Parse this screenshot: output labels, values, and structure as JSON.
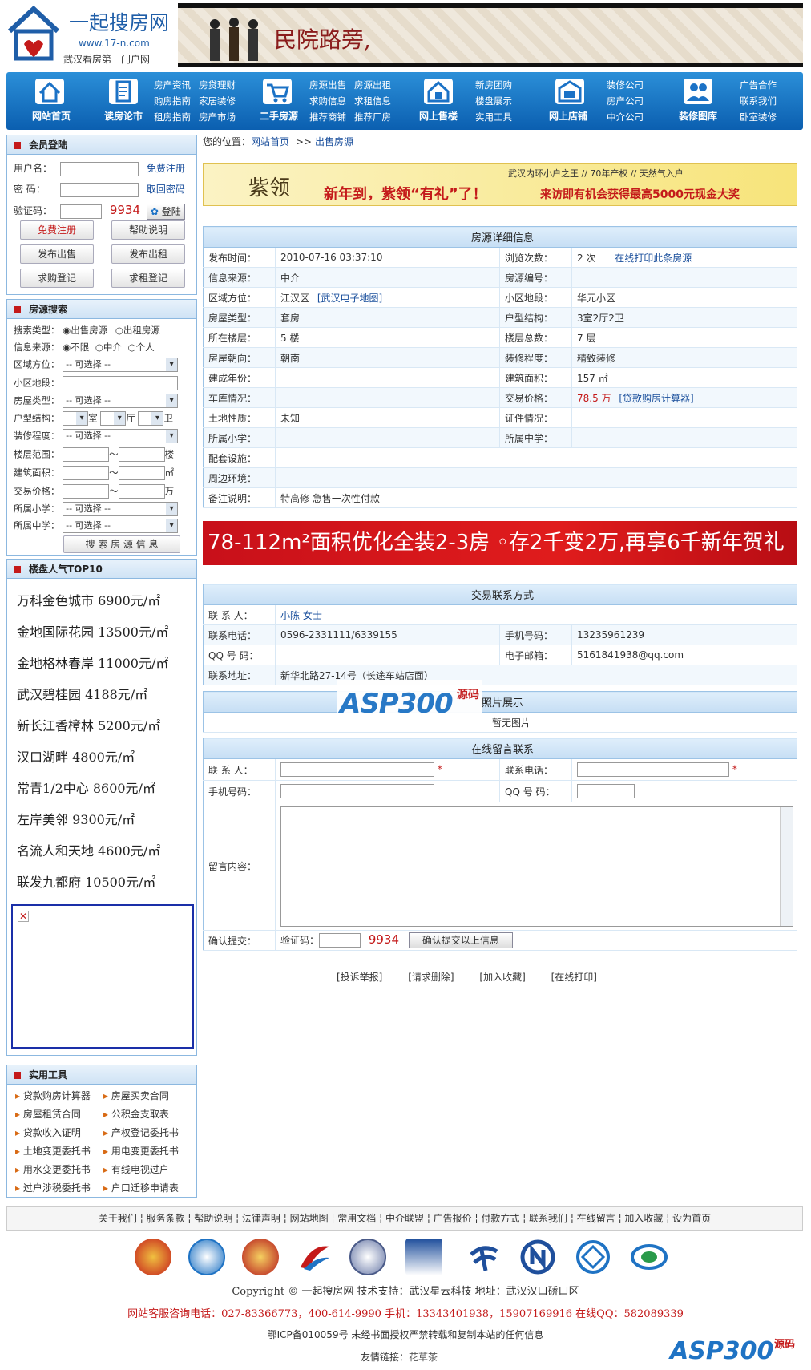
{
  "logo": {
    "title": "一起搜房网",
    "url": "www.17-n.com",
    "slogan": "武汉看房第一门户网"
  },
  "banner": {
    "text": "民院路旁,"
  },
  "nav": {
    "items": [
      {
        "label": "网站首页",
        "links": []
      },
      {
        "label": "读房论市",
        "links": [
          "房产资讯",
          "房贷理财",
          "购房指南",
          "家居装修",
          "租房指南",
          "房产市场"
        ]
      },
      {
        "label": "二手房源",
        "links": [
          "房源出售",
          "房源出租",
          "求购信息",
          "求租信息",
          "推荐商铺",
          "推荐厂房"
        ]
      },
      {
        "label": "网上售楼",
        "links": [
          "新房团购",
          "楼盘展示",
          "实用工具"
        ]
      },
      {
        "label": "网上店铺",
        "links": [
          "装修公司",
          "房产公司",
          "中介公司"
        ]
      },
      {
        "label": "装修图库",
        "links": [
          "广告合作",
          "联系我们",
          "卧室装修"
        ]
      }
    ]
  },
  "login": {
    "title": "会员登陆",
    "username_label": "用户名：",
    "password_label": "密  码：",
    "captcha_label": "验证码：",
    "captcha": "9934",
    "register_link": "免费注册",
    "forgot_link": "取回密码",
    "login_button": "登陆",
    "buttons": [
      "免费注册",
      "帮助说明",
      "发布出售",
      "发布出租",
      "求购登记",
      "求租登记"
    ]
  },
  "search": {
    "title": "房源搜索",
    "type_label": "搜索类型：",
    "type_options": [
      "出售房源",
      "出租房源"
    ],
    "source_label": "信息来源：",
    "source_options": [
      "不限",
      "中介",
      "个人"
    ],
    "district_label": "区域方位：",
    "community_label": "小区地段：",
    "housetype_label": "房屋类型：",
    "layout_label": "户型结构：",
    "layout_units": [
      "室",
      "厅",
      "卫"
    ],
    "decor_label": "装修程度：",
    "floor_label": "楼层范围：",
    "floor_unit": "楼",
    "area_label": "建筑面积：",
    "area_unit": "㎡",
    "price_label": "交易价格：",
    "price_unit": "万",
    "primary_label": "所属小学：",
    "middle_label": "所属中学：",
    "select_default": "-- 可选择 --",
    "tilde": "～",
    "search_button": "搜 索 房 源 信 息"
  },
  "top10": {
    "title": "楼盘人气TOP10",
    "items": [
      "万科金色城市  6900元/㎡",
      "金地国际花园  13500元/㎡",
      "金地格林春岸  11000元/㎡",
      "武汉碧桂园  4188元/㎡",
      "新长江香樟林  5200元/㎡",
      "汉口湖畔  4800元/㎡",
      "常青1/2中心  8600元/㎡",
      "左岸美邻  9300元/㎡",
      "名流人和天地  4600元/㎡",
      "联发九都府  10500元/㎡"
    ]
  },
  "tools": {
    "title": "实用工具",
    "items": [
      "贷款购房计算器",
      "房屋买卖合同",
      "房屋租赁合同",
      "公积金支取表",
      "贷款收入证明",
      "产权登记委托书",
      "土地变更委托书",
      "用电变更委托书",
      "用水变更委托书",
      "有线电视过户",
      "过户涉税委托书",
      "户口迁移申请表"
    ]
  },
  "breadcrumb": {
    "prefix": "您的位置：",
    "home": "网站首页",
    "sep": ">>",
    "current": "出售房源"
  },
  "ad": {
    "brand": "紫领",
    "line1": "武汉内环小户之王 // 70年产权 // 天然气入户",
    "line2": "新年到，紫领“有礼”了！",
    "line3": "来访即有机会获得最高5000元现金大奖"
  },
  "detail": {
    "title": "房源详细信息",
    "rows": [
      [
        "发布时间：",
        "2010-07-16 03:37:10",
        "浏览次数：",
        "2 次"
      ],
      [
        "信息来源：",
        "中介",
        "房源编号：",
        ""
      ],
      [
        "区域方位：",
        "江汉区",
        "小区地段：",
        "华元小区"
      ],
      [
        "房屋类型：",
        "套房",
        "户型结构：",
        "3室2厅2卫"
      ],
      [
        "所在楼层：",
        "5 楼",
        "楼层总数：",
        "7 层"
      ],
      [
        "房屋朝向：",
        "朝南",
        "装修程度：",
        "精致装修"
      ],
      [
        "建成年份：",
        "",
        "建筑面积：",
        "157 ㎡"
      ],
      [
        "车库情况：",
        "",
        "交易价格：",
        "78.5 万"
      ],
      [
        "土地性质：",
        "未知",
        "证件情况：",
        ""
      ],
      [
        "所属小学：",
        "",
        "所属中学：",
        ""
      ]
    ],
    "print_link": "在线打印此条房源",
    "map_link": "[武汉电子地图]",
    "calc_link": "[贷款购房计算器]",
    "facilities_label": "配套设施：",
    "surroundings_label": "周边环境：",
    "remark_label": "备注说明：",
    "remark": "特高修 急售一次性付款"
  },
  "redbanner": {
    "text": "78-112m²面积优化全装2-3房     ◦存2千变2万,再享6千新年贺礼"
  },
  "contact": {
    "title": "交易联系方式",
    "name_label": "联 系 人：",
    "name": "小陈 女士",
    "phone_label": "联系电话：",
    "phone": "0596-2331111/6339155",
    "mobile_label": "手机号码：",
    "mobile": "13235961239",
    "qq_label": "QQ 号 码：",
    "qq": "",
    "email_label": "电子邮箱：",
    "email": "5161841938@qq.com",
    "addr_label": "联系地址：",
    "addr": "新华北路27-14号（长途车站店面）"
  },
  "photos": {
    "title": "照片展示",
    "empty": "暂无图片",
    "watermark": "ASP300",
    "watermark_sub": "源码"
  },
  "message": {
    "title": "在线留言联系",
    "name_label": "联 系 人：",
    "phone_label": "联系电话：",
    "mobile_label": "手机号码：",
    "qq_label": "QQ 号 码：",
    "content_label": "留言内容：",
    "confirm_label": "确认提交：",
    "captcha_label": "验证码：",
    "captcha": "9934",
    "submit": "确认提交以上信息",
    "required": "*"
  },
  "actions": [
    "[投诉举报]",
    "[请求删除]",
    "[加入收藏]",
    "[在线打印]"
  ],
  "footer": {
    "links": [
      "关于我们",
      "服务条款",
      "帮助说明",
      "法律声明",
      "网站地图",
      "常用文档",
      "中介联盟",
      "广告报价",
      "付款方式",
      "联系我们",
      "在线留言",
      "加入收藏",
      "设为首页"
    ],
    "copyright": "Copyright © 一起搜房网  技术支持：武汉星云科技  地址：武汉汉口硚口区",
    "service": "网站客服咨询电话：027-83366773，400-614-9990  手机：13343401938，15907169916  在线QQ：582089339",
    "icp": "鄂ICP备010059号  未经书面授权严禁转载和复制本站的任何信息",
    "friends_label": "友情链接：",
    "friends": "花草茶"
  },
  "colors": {
    "accent": "#1f73c4",
    "red": "#c41a1a"
  }
}
